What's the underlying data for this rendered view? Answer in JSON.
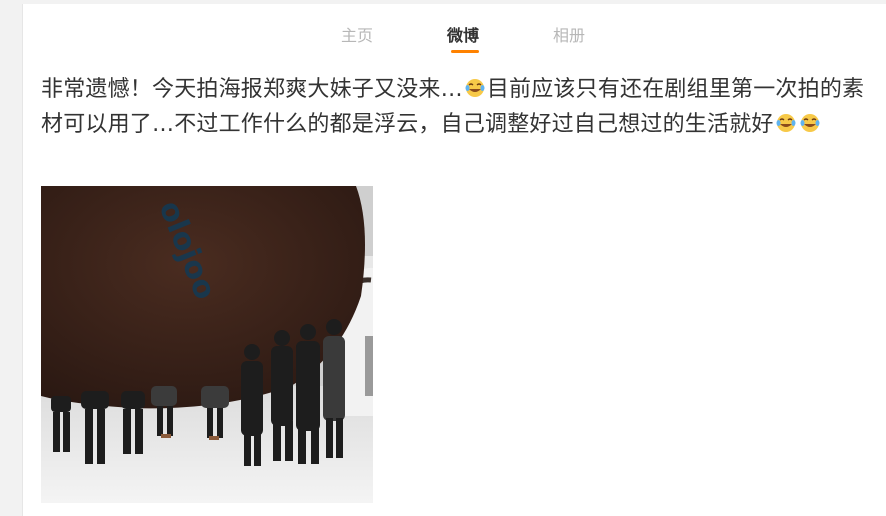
{
  "tabs": [
    {
      "label": "主页"
    },
    {
      "label": "微博"
    },
    {
      "label": "相册"
    }
  ],
  "post": {
    "text_part1": "非常遗憾！今天拍海报郑爽大妹子又没来…",
    "emoji1": "laugh-cry-emoji",
    "text_part2": "目前应该只有还在剧组里第一次拍的素材可以用了…不过工作什么的都是浮云，自己调整好过自己想过的生活就好",
    "emoji2": "laugh-cry-emoji",
    "emoji3": "laugh-cry-emoji"
  },
  "photo": {
    "lettering": "olojoo"
  },
  "colors": {
    "accent": "#ff8200",
    "text": "#333333",
    "tab_inactive": "#b7b7b7"
  }
}
